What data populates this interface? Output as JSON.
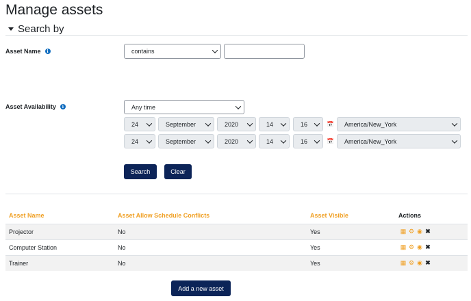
{
  "page": {
    "title": "Manage assets"
  },
  "search": {
    "section_title": "Search by",
    "asset_name": {
      "label": "Asset Name",
      "operator": "contains",
      "value": ""
    },
    "availability": {
      "label": "Asset Availability",
      "mode": "Any time",
      "from": {
        "day": "24",
        "month": "September",
        "year": "2020",
        "hour": "14",
        "minute": "16",
        "timezone": "America/New_York"
      },
      "to": {
        "day": "24",
        "month": "September",
        "year": "2020",
        "hour": "14",
        "minute": "16",
        "timezone": "America/New_York"
      }
    },
    "search_label": "Search",
    "clear_label": "Clear"
  },
  "table": {
    "headers": [
      "Asset Name",
      "Asset Allow Schedule Conflicts",
      "Asset Visible",
      "Actions"
    ],
    "rows": [
      {
        "name": "Projector",
        "conflicts": "No",
        "visible": "Yes"
      },
      {
        "name": "Computer Station",
        "conflicts": "No",
        "visible": "Yes"
      },
      {
        "name": "Trainer",
        "conflicts": "No",
        "visible": "Yes"
      }
    ],
    "action_icons": [
      "calendar-icon",
      "gear-icon",
      "eye-icon",
      "delete-icon"
    ]
  },
  "add_button_label": "Add a new asset",
  "colors": {
    "accent_orange": "#f0a024",
    "primary_button": "#0c2458",
    "info_blue": "#0f6cbf"
  }
}
